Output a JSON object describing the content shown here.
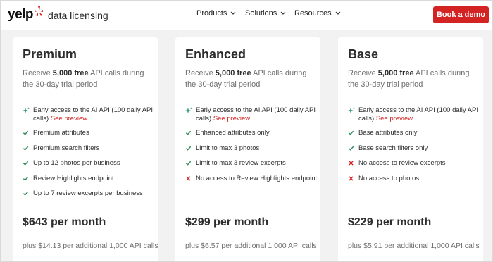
{
  "nav": {
    "logo_word": "yelp",
    "logo_sub": "data licensing",
    "menu": [
      {
        "label": "Products"
      },
      {
        "label": "Solutions"
      },
      {
        "label": "Resources"
      }
    ],
    "cta_label": "Book a demo"
  },
  "plans": [
    {
      "name": "Premium",
      "trial_prefix": "Receive ",
      "trial_bold": "5,000 free",
      "trial_suffix": " API calls during the 30-day trial period",
      "features": [
        {
          "icon": "sparkle-icon",
          "text": "Early access to the AI API (100 daily API calls) ",
          "link": "See preview"
        },
        {
          "icon": "check-icon",
          "text": "Premium attributes"
        },
        {
          "icon": "check-icon",
          "text": "Premium search filters"
        },
        {
          "icon": "check-icon",
          "text": "Up to 12 photos per business"
        },
        {
          "icon": "check-icon",
          "text": "Review Highlights endpoint"
        },
        {
          "icon": "check-icon",
          "text": "Up to 7 review excerpts per business"
        }
      ],
      "price": "$643 per month",
      "plus": "plus $14.13 per additional 1,000 API calls"
    },
    {
      "name": "Enhanced",
      "trial_prefix": "Receive ",
      "trial_bold": "5,000 free",
      "trial_suffix": " API calls during the 30-day trial period",
      "features": [
        {
          "icon": "sparkle-icon",
          "text": "Early access to the AI API (100 daily API calls) ",
          "link": "See preview"
        },
        {
          "icon": "check-icon",
          "text": "Enhanced attributes only"
        },
        {
          "icon": "check-icon",
          "text": "Limit to max 3 photos"
        },
        {
          "icon": "check-icon",
          "text": "Limit to max 3 review excerpts"
        },
        {
          "icon": "x-icon",
          "text": "No access to Review Highlights endpoint"
        }
      ],
      "price": "$299 per month",
      "plus": "plus $6.57 per additional 1,000 API calls"
    },
    {
      "name": "Base",
      "trial_prefix": "Receive ",
      "trial_bold": "5,000 free",
      "trial_suffix": " API calls during the 30-day trial period",
      "features": [
        {
          "icon": "sparkle-icon",
          "text": "Early access to the AI API (100 daily API calls) ",
          "link": "See preview"
        },
        {
          "icon": "check-icon",
          "text": "Base attributes only"
        },
        {
          "icon": "check-icon",
          "text": "Base search filters only"
        },
        {
          "icon": "x-icon",
          "text": "No access to review excerpts"
        },
        {
          "icon": "x-icon",
          "text": "No access to photos"
        }
      ],
      "price": "$229 per month",
      "plus": "plus $5.91 per additional 1,000 API calls"
    }
  ],
  "colors": {
    "brand_red": "#d32323",
    "check_green": "#2e8b57",
    "x_red": "#d32323",
    "sparkle_green": "#3a9e72"
  }
}
